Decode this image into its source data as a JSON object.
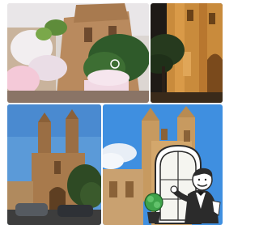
{
  "gallery": {
    "photos": [
      {
        "subject": "church-facade-with-floral-decorations"
      },
      {
        "subject": "church-facade-at-night"
      },
      {
        "subject": "baroque-church-with-twin-towers"
      },
      {
        "subject": "church-towers-against-blue-sky"
      }
    ],
    "overlay": {
      "icon": "restaurant-waiter-icon"
    }
  }
}
